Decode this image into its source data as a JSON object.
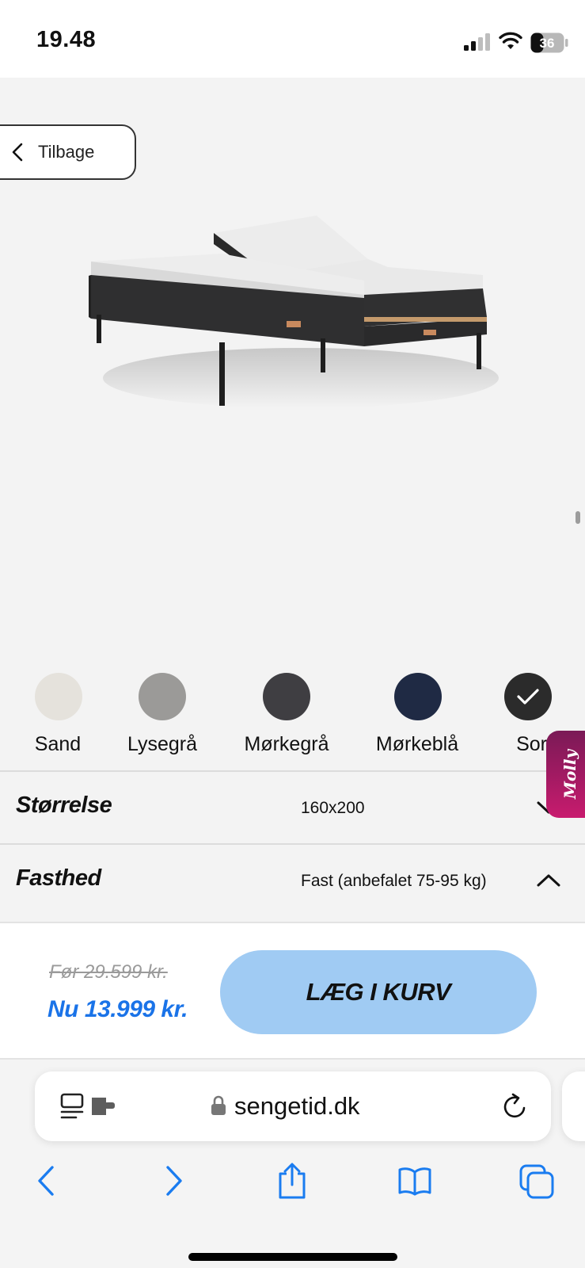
{
  "status_bar": {
    "time": "19.48",
    "battery": "36"
  },
  "hero": {
    "back_label": "Tilbage"
  },
  "colors": {
    "selected": "Sort",
    "options": [
      {
        "name": "Sand",
        "hex": "#e5e2dc"
      },
      {
        "name": "Lysegrå",
        "hex": "#9b9a98"
      },
      {
        "name": "Mørkegrå",
        "hex": "#3f3e42"
      },
      {
        "name": "Mørkeblå",
        "hex": "#1f2a44"
      },
      {
        "name": "Sort",
        "hex": "#2b2b2b"
      }
    ]
  },
  "chat_widget": {
    "label": "Molly"
  },
  "options": {
    "size": {
      "title": "Størrelse",
      "value": "160x200"
    },
    "firmness": {
      "title": "Fasthed",
      "value": "Fast (anbefalet 75-95 kg)"
    }
  },
  "price": {
    "old": "Før 29.599 kr.",
    "new": "Nu 13.999 kr.",
    "cta": "LÆG I KURV",
    "accent": "#1a73e8",
    "button_color": "#a0cbf3"
  },
  "browser": {
    "url": "sengetid.dk",
    "toolbar_icons": [
      "back-icon",
      "forward-icon",
      "share-icon",
      "bookmarks-icon",
      "tabs-icon"
    ],
    "tint": "#1a7cf0"
  }
}
